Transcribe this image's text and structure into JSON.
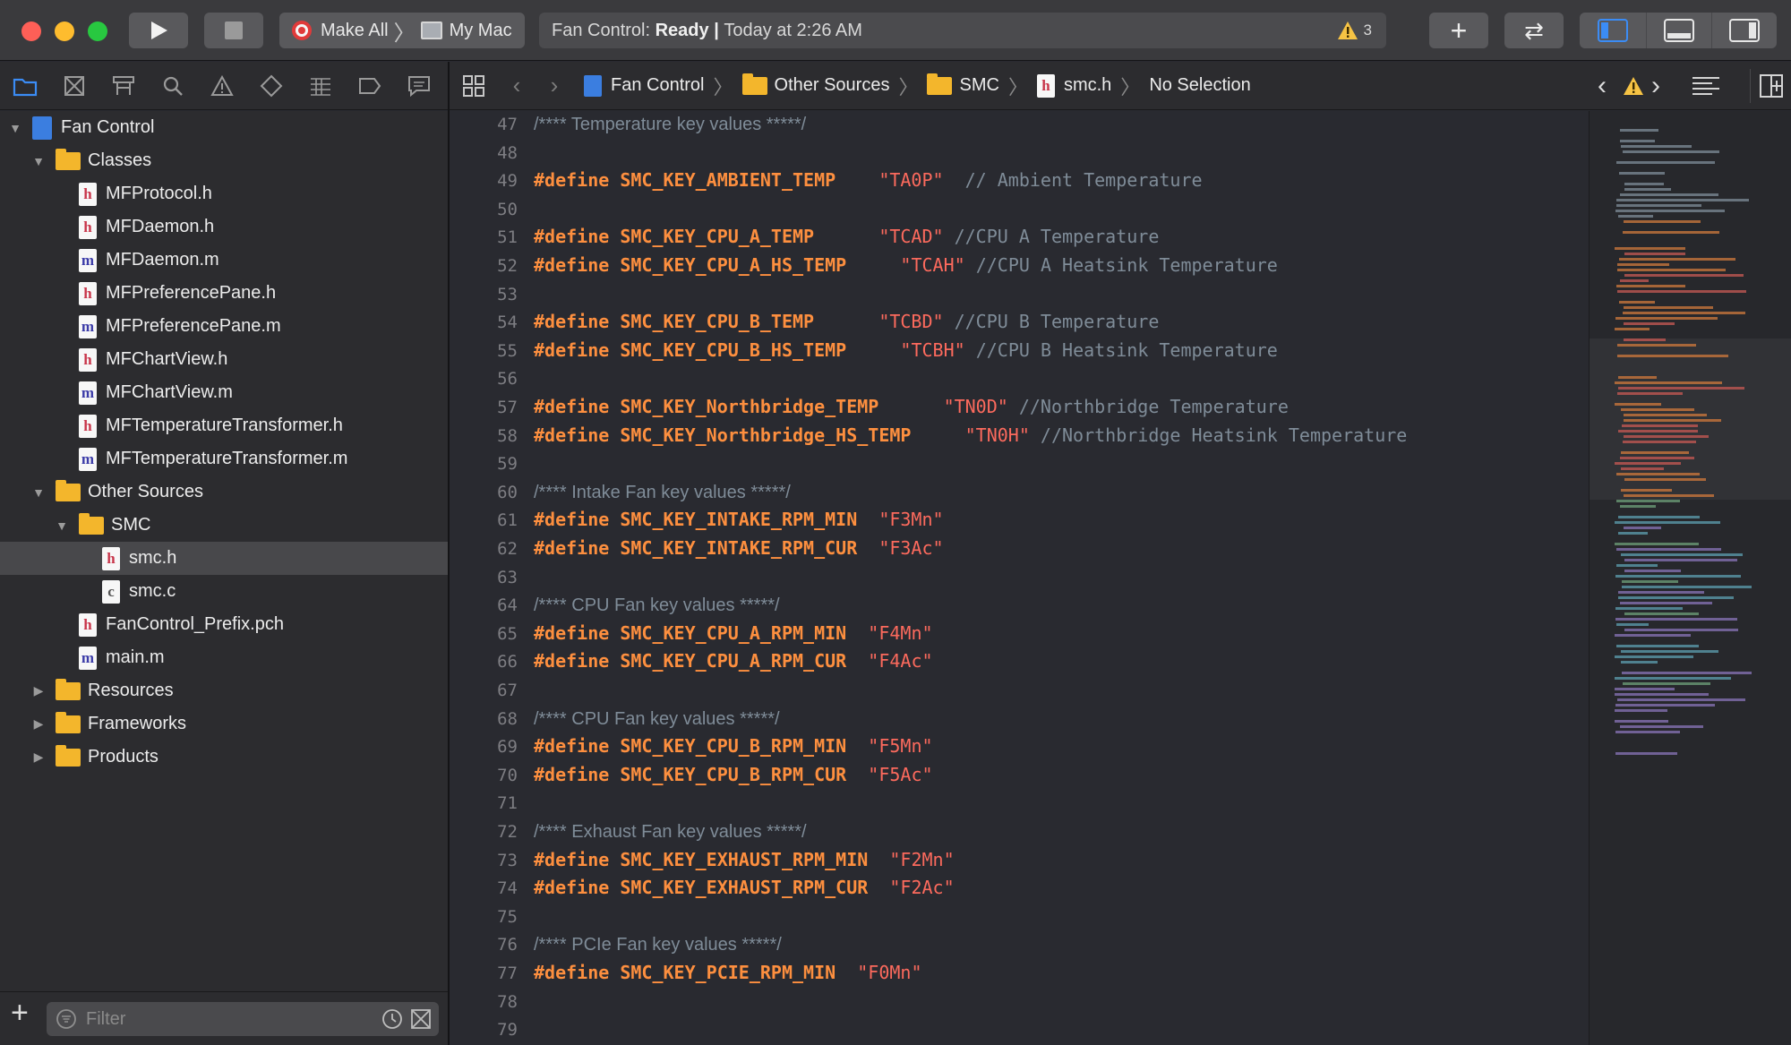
{
  "window": {
    "traffic_lights": {
      "close": "#fe5f57",
      "minimize": "#febc2e",
      "zoom": "#28c840"
    }
  },
  "toolbar": {
    "run_icon": "play-icon",
    "stop_icon": "stop-icon",
    "scheme_name": "Make All",
    "destination": "My Mac",
    "status_prefix": "Fan Control: ",
    "status_state": "Ready",
    "status_sep": " | ",
    "status_time": "Today at 2:26 AM",
    "warning_count": "3",
    "add_icon": "plus-icon",
    "review_icon": "swap-arrows-icon"
  },
  "navigator": {
    "tabs": [
      "folder-icon",
      "source-control-icon",
      "symbol-icon",
      "search-icon",
      "warning-icon",
      "test-icon",
      "debug-icon",
      "breakpoint-icon",
      "report-icon"
    ],
    "filter_placeholder": "Filter",
    "tree": [
      {
        "label": "Fan Control",
        "type": "project",
        "depth": 0,
        "expanded": true
      },
      {
        "label": "Classes",
        "type": "folder",
        "depth": 1,
        "expanded": true
      },
      {
        "label": "MFProtocol.h",
        "type": "h",
        "depth": 2
      },
      {
        "label": "MFDaemon.h",
        "type": "h",
        "depth": 2
      },
      {
        "label": "MFDaemon.m",
        "type": "m",
        "depth": 2
      },
      {
        "label": "MFPreferencePane.h",
        "type": "h",
        "depth": 2
      },
      {
        "label": "MFPreferencePane.m",
        "type": "m",
        "depth": 2
      },
      {
        "label": "MFChartView.h",
        "type": "h",
        "depth": 2
      },
      {
        "label": "MFChartView.m",
        "type": "m",
        "depth": 2
      },
      {
        "label": "MFTemperatureTransformer.h",
        "type": "h",
        "depth": 2
      },
      {
        "label": "MFTemperatureTransformer.m",
        "type": "m",
        "depth": 2
      },
      {
        "label": "Other Sources",
        "type": "folder",
        "depth": 1,
        "expanded": true
      },
      {
        "label": "SMC",
        "type": "folder",
        "depth": 2,
        "expanded": true
      },
      {
        "label": "smc.h",
        "type": "h",
        "depth": 3,
        "selected": true
      },
      {
        "label": "smc.c",
        "type": "c",
        "depth": 3
      },
      {
        "label": "FanControl_Prefix.pch",
        "type": "h",
        "depth": 2
      },
      {
        "label": "main.m",
        "type": "m",
        "depth": 2
      },
      {
        "label": "Resources",
        "type": "folder",
        "depth": 1,
        "expanded": false
      },
      {
        "label": "Frameworks",
        "type": "folder",
        "depth": 1,
        "expanded": false
      },
      {
        "label": "Products",
        "type": "folder",
        "depth": 1,
        "expanded": false
      }
    ]
  },
  "jumpbar": {
    "crumbs": [
      "Fan Control",
      "Other Sources",
      "SMC",
      "smc.h",
      "No Selection"
    ]
  },
  "editor": {
    "lines": [
      {
        "n": "47",
        "parts": [
          [
            "cm2",
            "/**** Temperature key values *****/"
          ]
        ]
      },
      {
        "n": "48",
        "parts": []
      },
      {
        "n": "49",
        "parts": [
          [
            "kw",
            "#define SMC_KEY_AMBIENT_TEMP    "
          ],
          [
            "str",
            "\"TA0P\""
          ],
          [
            "cm",
            "  // Ambient Temperature"
          ]
        ]
      },
      {
        "n": "50",
        "parts": []
      },
      {
        "n": "51",
        "parts": [
          [
            "kw",
            "#define SMC_KEY_CPU_A_TEMP      "
          ],
          [
            "str",
            "\"TCAD\""
          ],
          [
            "cm",
            " //CPU A Temperature"
          ]
        ]
      },
      {
        "n": "52",
        "parts": [
          [
            "kw",
            "#define SMC_KEY_CPU_A_HS_TEMP     "
          ],
          [
            "str",
            "\"TCAH\""
          ],
          [
            "cm",
            " //CPU A Heatsink Temperature"
          ]
        ]
      },
      {
        "n": "53",
        "parts": []
      },
      {
        "n": "54",
        "parts": [
          [
            "kw",
            "#define SMC_KEY_CPU_B_TEMP      "
          ],
          [
            "str",
            "\"TCBD\""
          ],
          [
            "cm",
            " //CPU B Temperature"
          ]
        ]
      },
      {
        "n": "55",
        "parts": [
          [
            "kw",
            "#define SMC_KEY_CPU_B_HS_TEMP     "
          ],
          [
            "str",
            "\"TCBH\""
          ],
          [
            "cm",
            " //CPU B Heatsink Temperature"
          ]
        ]
      },
      {
        "n": "56",
        "parts": []
      },
      {
        "n": "57",
        "parts": [
          [
            "kw",
            "#define SMC_KEY_Northbridge_TEMP      "
          ],
          [
            "str",
            "\"TN0D\""
          ],
          [
            "cm",
            " //Northbridge Temperature"
          ]
        ]
      },
      {
        "n": "58",
        "parts": [
          [
            "kw",
            "#define SMC_KEY_Northbridge_HS_TEMP     "
          ],
          [
            "str",
            "\"TN0H\""
          ],
          [
            "cm",
            " //Northbridge Heatsink Temperature"
          ]
        ]
      },
      {
        "n": "59",
        "parts": []
      },
      {
        "n": "60",
        "parts": [
          [
            "cm2",
            "/**** Intake Fan key values *****/"
          ]
        ]
      },
      {
        "n": "61",
        "parts": [
          [
            "kw",
            "#define SMC_KEY_INTAKE_RPM_MIN  "
          ],
          [
            "str",
            "\"F3Mn\""
          ]
        ]
      },
      {
        "n": "62",
        "parts": [
          [
            "kw",
            "#define SMC_KEY_INTAKE_RPM_CUR  "
          ],
          [
            "str",
            "\"F3Ac\""
          ]
        ]
      },
      {
        "n": "63",
        "parts": []
      },
      {
        "n": "64",
        "parts": [
          [
            "cm2",
            "/**** CPU Fan key values *****/"
          ]
        ]
      },
      {
        "n": "65",
        "parts": [
          [
            "kw",
            "#define SMC_KEY_CPU_A_RPM_MIN  "
          ],
          [
            "str",
            "\"F4Mn\""
          ]
        ]
      },
      {
        "n": "66",
        "parts": [
          [
            "kw",
            "#define SMC_KEY_CPU_A_RPM_CUR  "
          ],
          [
            "str",
            "\"F4Ac\""
          ]
        ]
      },
      {
        "n": "67",
        "parts": []
      },
      {
        "n": "68",
        "parts": [
          [
            "cm2",
            "/**** CPU Fan key values *****/"
          ]
        ]
      },
      {
        "n": "69",
        "parts": [
          [
            "kw",
            "#define SMC_KEY_CPU_B_RPM_MIN  "
          ],
          [
            "str",
            "\"F5Mn\""
          ]
        ]
      },
      {
        "n": "70",
        "parts": [
          [
            "kw",
            "#define SMC_KEY_CPU_B_RPM_CUR  "
          ],
          [
            "str",
            "\"F5Ac\""
          ]
        ]
      },
      {
        "n": "71",
        "parts": []
      },
      {
        "n": "72",
        "parts": [
          [
            "cm2",
            "/**** Exhaust Fan key values *****/"
          ]
        ]
      },
      {
        "n": "73",
        "parts": [
          [
            "kw",
            "#define SMC_KEY_EXHAUST_RPM_MIN  "
          ],
          [
            "str",
            "\"F2Mn\""
          ]
        ]
      },
      {
        "n": "74",
        "parts": [
          [
            "kw",
            "#define SMC_KEY_EXHAUST_RPM_CUR  "
          ],
          [
            "str",
            "\"F2Ac\""
          ]
        ]
      },
      {
        "n": "75",
        "parts": []
      },
      {
        "n": "76",
        "parts": [
          [
            "cm2",
            "/**** PCIe Fan key values *****/"
          ]
        ]
      },
      {
        "n": "77",
        "parts": [
          [
            "kw",
            "#define SMC_KEY_PCIE_RPM_MIN  "
          ],
          [
            "str",
            "\"F0Mn\""
          ]
        ]
      },
      {
        "n": "78",
        "parts": []
      },
      {
        "n": "79",
        "parts": []
      }
    ]
  },
  "colors": {
    "keyword": "#fd8f3f",
    "string": "#fc6a5d",
    "comment": "#7f8c98",
    "accent": "#3b8cf5",
    "warning": "#f6c344"
  }
}
